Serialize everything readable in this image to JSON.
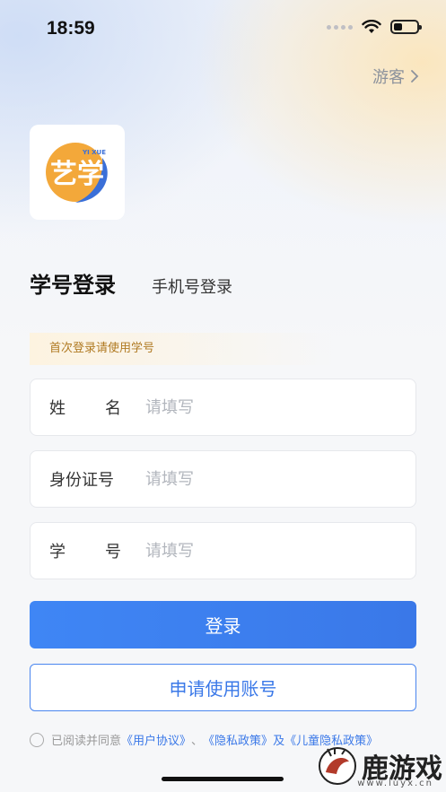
{
  "status": {
    "time": "18:59"
  },
  "header": {
    "guest_label": "游客"
  },
  "logo": {
    "primary": "艺学",
    "sub": "YI XUE"
  },
  "tabs": [
    {
      "label": "学号登录",
      "active": true
    },
    {
      "label": "手机号登录",
      "active": false
    }
  ],
  "notice": "首次登录请使用学号",
  "fields": [
    {
      "label_a": "姓",
      "label_b": "名",
      "placeholder": "请填写"
    },
    {
      "label_a": "身份证号",
      "label_b": "",
      "placeholder": "请填写"
    },
    {
      "label_a": "学",
      "label_b": "号",
      "placeholder": "请填写"
    }
  ],
  "buttons": {
    "login": "登录",
    "apply": "申请使用账号"
  },
  "agreement": {
    "prefix": "已阅读并同意",
    "user_agreement": "《用户协议》",
    "sep": "、",
    "privacy": "《隐私政策》",
    "tail": "及《儿童隐私政策》"
  },
  "watermark": {
    "text": "鹿游戏",
    "url": "www.luyx.cn"
  },
  "colors": {
    "primary": "#3a78e8",
    "notice_text": "#b07a22",
    "logo_orange": "#f3a83a"
  }
}
